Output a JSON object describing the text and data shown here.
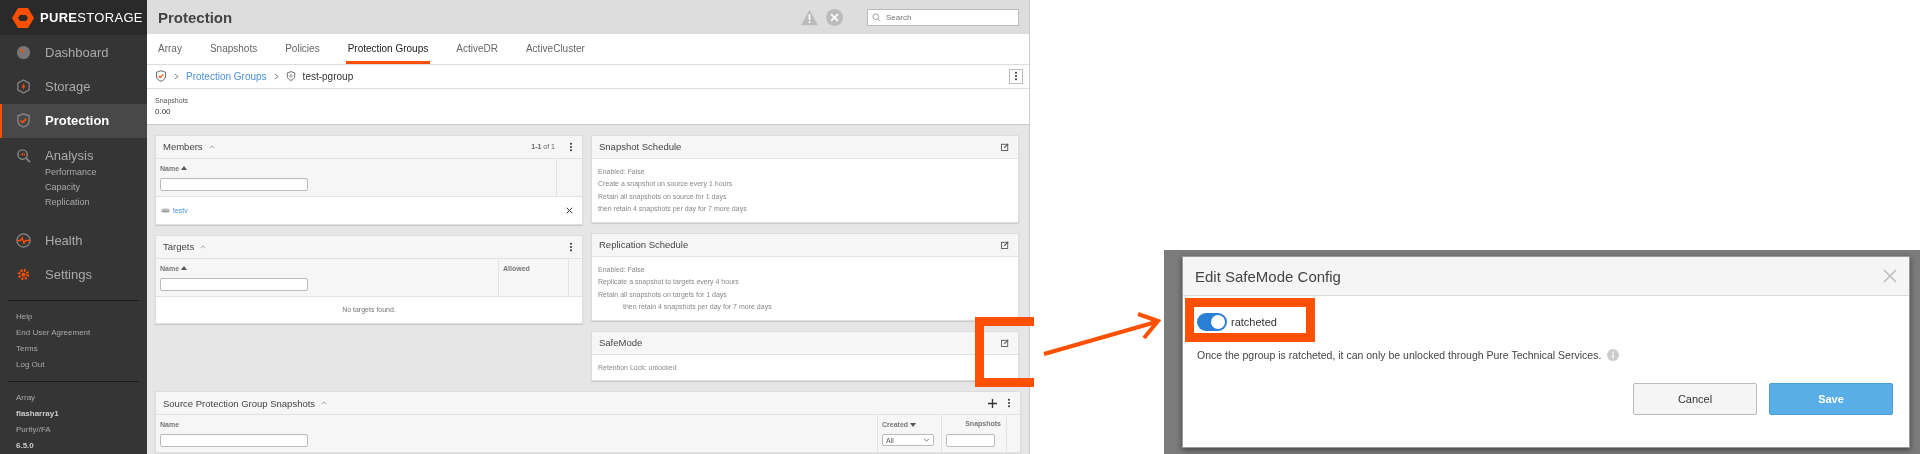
{
  "sidebar": {
    "brand": "**PURE**STORAGE",
    "items": [
      {
        "label": "Dashboard",
        "selected": false
      },
      {
        "label": "Storage",
        "selected": false
      },
      {
        "label": "Protection",
        "selected": true
      },
      {
        "label": "Analysis",
        "selected": false,
        "children": [
          "Performance",
          "Capacity",
          "Replication"
        ]
      },
      {
        "label": "Health",
        "selected": false
      },
      {
        "label": "Settings",
        "selected": false
      }
    ],
    "links": [
      "Help",
      "End User Agreement",
      "Terms",
      "Log Out"
    ],
    "array_info": [
      {
        "text": "Array",
        "bold": false
      },
      {
        "text": "flasharray1",
        "bold": true
      },
      {
        "text": "Purity//FA",
        "bold": false
      },
      {
        "text": "6.5.0",
        "bold": true
      }
    ]
  },
  "header": {
    "title": "Protection",
    "search": {
      "placeholder": "Search"
    }
  },
  "tabs": [
    {
      "label": "Array",
      "selected": false
    },
    {
      "label": "Snapshots",
      "selected": false
    },
    {
      "label": "Policies",
      "selected": false
    },
    {
      "label": "Protection Groups",
      "selected": true
    },
    {
      "label": "ActiveDR",
      "selected": false
    },
    {
      "label": "ActiveCluster",
      "selected": false
    }
  ],
  "breadcrumb": {
    "link": "Protection Groups",
    "current": "test-pgroup"
  },
  "summary": {
    "label": "Snapshots",
    "value": "0.00"
  },
  "members": {
    "title": "Members",
    "count": "**1-1** of 1",
    "column": "Name",
    "rows": [
      "testv"
    ]
  },
  "targets": {
    "title": "Targets",
    "columns": [
      "Name",
      "Allowed"
    ],
    "empty": "No targets found."
  },
  "schedules": [
    {
      "title": "Snapshot Schedule",
      "lines": [
        {
          "text": "Enabled: False",
          "indented": false
        },
        {
          "text": "Create a snapshot on source every 1 hours",
          "indented": false
        },
        {
          "text": "Retain all snapshots on source for 1 days",
          "indented": false
        },
        {
          "text": "then retain 4 snapshots per day for 7 more days",
          "indented": false
        }
      ]
    },
    {
      "title": "Replication Schedule",
      "lines": [
        {
          "text": "Enabled: False",
          "indented": false
        },
        {
          "text": "Replicate a snapshot to targets every 4 hours",
          "indented": false
        },
        {
          "text": "Retain all snapshots on targets for 1 days",
          "indented": false
        },
        {
          "text": "then retain 4 snapshots per day for 7 more days",
          "indented": true
        }
      ]
    },
    {
      "title": "SafeMode",
      "lines": [
        {
          "text": "Retention Lock: unlocked",
          "indented": false
        }
      ]
    }
  ],
  "source_snapshots": {
    "title": "Source Protection Group Snapshots",
    "columns": [
      "Name",
      "Created",
      "Snapshots"
    ],
    "created_filter": "All"
  },
  "dialog": {
    "title": "Edit SafeMode Config",
    "toggle": {
      "label": "ratcheted",
      "on": true
    },
    "note": "Once the pgroup is ratcheted, it can only be unlocked through Pure Technical Services.",
    "buttons": [
      {
        "label": "Cancel",
        "kind": "secondary"
      },
      {
        "label": "Save",
        "kind": "primary"
      }
    ]
  }
}
